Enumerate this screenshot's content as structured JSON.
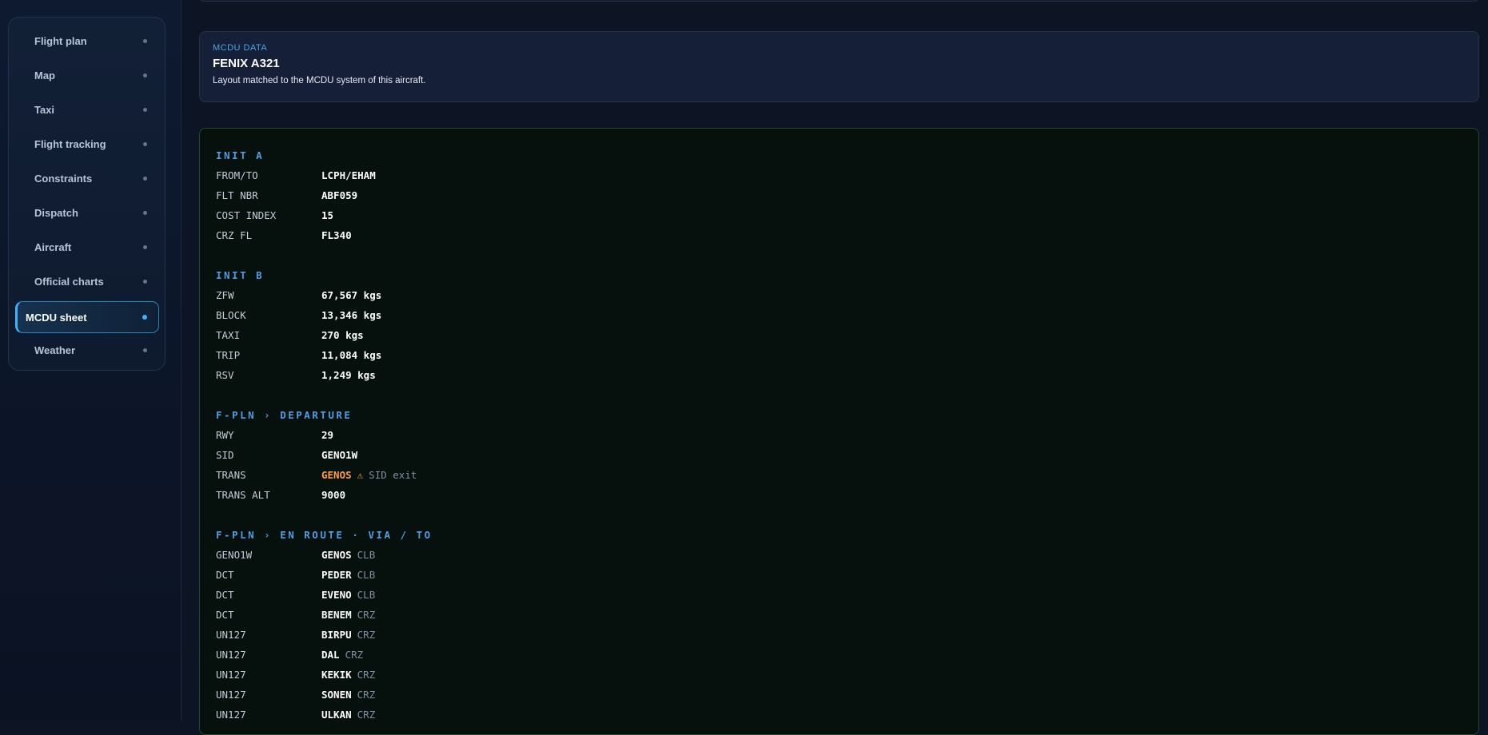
{
  "sidebar": {
    "items": [
      {
        "label": "Flight plan"
      },
      {
        "label": "Map"
      },
      {
        "label": "Taxi"
      },
      {
        "label": "Flight tracking"
      },
      {
        "label": "Constraints"
      },
      {
        "label": "Dispatch"
      },
      {
        "label": "Aircraft"
      },
      {
        "label": "Official charts"
      },
      {
        "label": "MCDU sheet",
        "active": true
      },
      {
        "label": "Weather"
      }
    ]
  },
  "info": {
    "kicker": "MCDU DATA",
    "title": "FENIX A321",
    "subtitle": "Layout matched to the MCDU system of this aircraft."
  },
  "mcdu": {
    "init_a": {
      "title": "INIT A",
      "rows": [
        {
          "key": "FROM/TO",
          "value": "LCPH/EHAM"
        },
        {
          "key": "FLT NBR",
          "value": "ABF059"
        },
        {
          "key": "COST INDEX",
          "value": "15"
        },
        {
          "key": "CRZ FL",
          "value": "FL340"
        }
      ]
    },
    "init_b": {
      "title": "INIT B",
      "rows": [
        {
          "key": "ZFW",
          "value": "67,567 kgs"
        },
        {
          "key": "BLOCK",
          "value": "13,346 kgs"
        },
        {
          "key": "TAXI",
          "value": "270 kgs"
        },
        {
          "key": "TRIP",
          "value": "11,084 kgs"
        },
        {
          "key": "RSV",
          "value": "1,249 kgs"
        }
      ]
    },
    "departure": {
      "title": "F-PLN › DEPARTURE",
      "rows": [
        {
          "key": "RWY",
          "value": "29"
        },
        {
          "key": "SID",
          "value": "GENO1W"
        },
        {
          "key": "TRANS",
          "value": "GENOS",
          "warn_icon": "⚠",
          "note": "SID exit"
        },
        {
          "key": "TRANS ALT",
          "value": "9000"
        }
      ]
    },
    "enroute": {
      "title": "F-PLN › EN ROUTE · VIA / TO",
      "rows": [
        {
          "via": "GENO1W",
          "to": "GENOS",
          "phase": "CLB"
        },
        {
          "via": "DCT",
          "to": "PEDER",
          "phase": "CLB"
        },
        {
          "via": "DCT",
          "to": "EVENO",
          "phase": "CLB"
        },
        {
          "via": "DCT",
          "to": "BENEM",
          "phase": "CRZ"
        },
        {
          "via": "UN127",
          "to": "BIRPU",
          "phase": "CRZ"
        },
        {
          "via": "UN127",
          "to": "DAL",
          "phase": "CRZ"
        },
        {
          "via": "UN127",
          "to": "KEKIK",
          "phase": "CRZ"
        },
        {
          "via": "UN127",
          "to": "SONEN",
          "phase": "CRZ"
        },
        {
          "via": "UN127",
          "to": "ULKAN",
          "phase": "CRZ"
        }
      ]
    }
  }
}
